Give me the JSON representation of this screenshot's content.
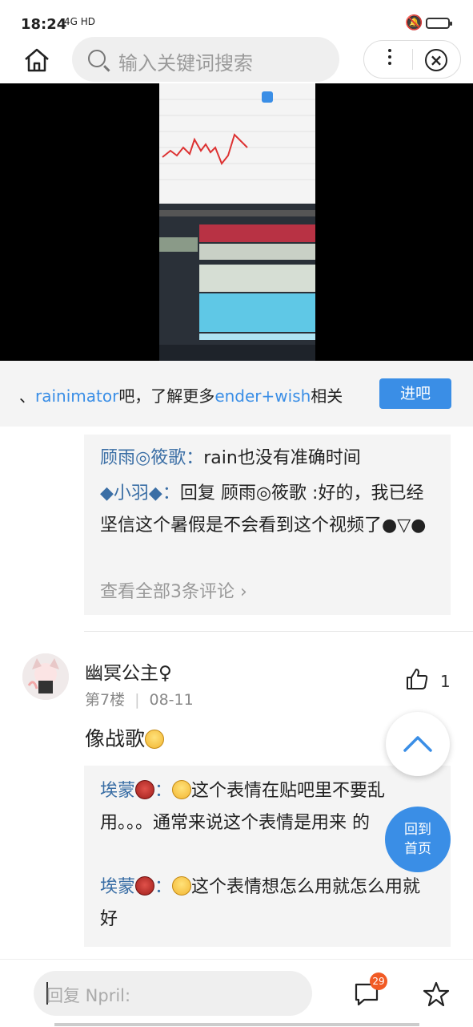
{
  "status_bar": {
    "time": "18:24",
    "signal_label": "4G HD"
  },
  "nav": {
    "search_placeholder": "输入关键词搜索"
  },
  "banner": {
    "prefix": "、",
    "keyword1": "rainimator",
    "middle": "吧，了解更多",
    "keyword2": "ender+wish",
    "suffix": "相关",
    "button": "进吧"
  },
  "sub_comments_1": {
    "items": [
      {
        "user": "顾雨◎筱歌",
        "sep": "：",
        "text": "rain也没有准确时间"
      },
      {
        "user": "◆小羽◆",
        "sep": "：",
        "text": "回复 顾雨◎筱歌 :好的，我已经坚信这个暑假是不会看到这个视频了●▽●"
      }
    ],
    "more": "查看全部3条评论"
  },
  "post": {
    "username": "幽冥公主♀",
    "floor": "第7楼",
    "date": "08-11",
    "likes": "1",
    "content": "像战歌"
  },
  "sub_comments_2": {
    "items": [
      {
        "user": "埃蒙",
        "sep": "：",
        "text": "这个表情在贴吧里不要乱用。。。通常来说这个表情是用来 的"
      },
      {
        "user": "埃蒙",
        "sep": "：",
        "text": "这个表情想怎么用就怎么用就好"
      }
    ]
  },
  "float": {
    "home_label_1": "回到",
    "home_label_2": "首页"
  },
  "bottom": {
    "reply_placeholder": "回复 Npril:",
    "message_badge": "29"
  }
}
